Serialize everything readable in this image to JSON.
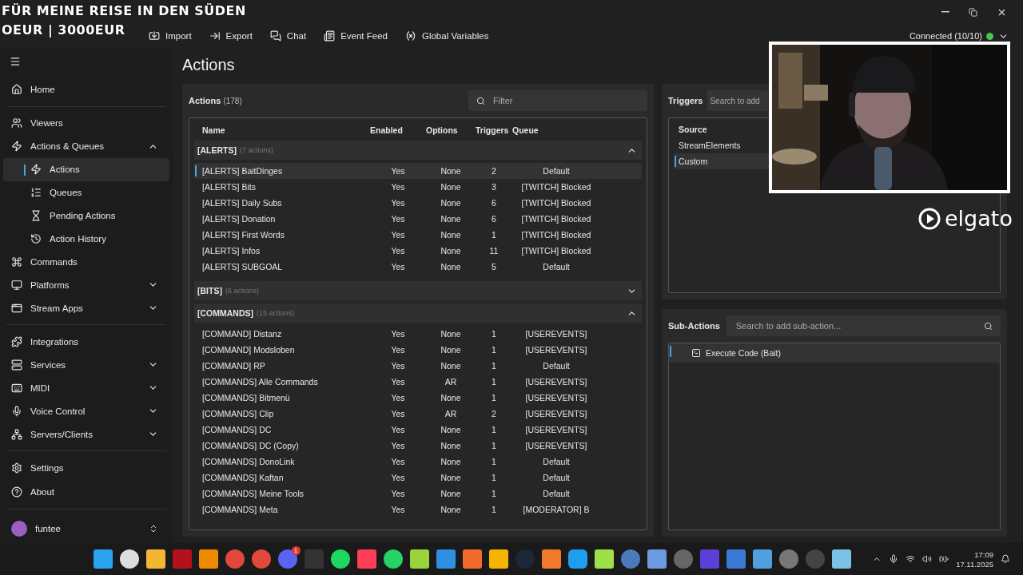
{
  "overlay_banner": [
    "FÜR MEINE REISE IN DEN SÜDEN",
    "OEUR | 3000EUR"
  ],
  "toolbar": [
    {
      "kind": "import",
      "label": "Import"
    },
    {
      "kind": "export",
      "label": "Export"
    },
    {
      "kind": "chat",
      "label": "Chat"
    },
    {
      "kind": "feed",
      "label": "Event Feed"
    },
    {
      "kind": "variables",
      "label": "Global Variables"
    }
  ],
  "connection": {
    "label": "Connected (10/10)",
    "color": "#4cc24a"
  },
  "sidebar": {
    "items": [
      {
        "label": "Home"
      },
      {
        "label": "Viewers"
      },
      {
        "label": "Actions & Queues",
        "expanded": true,
        "children": [
          {
            "label": "Actions",
            "selected": true
          },
          {
            "label": "Queues",
            "selected": false
          },
          {
            "label": "Pending Actions",
            "selected": false
          },
          {
            "label": "Action History",
            "selected": false
          }
        ]
      },
      {
        "label": "Commands"
      },
      {
        "label": "Platforms",
        "expanded": false
      },
      {
        "label": "Stream Apps",
        "expanded": false
      },
      {
        "label": "Integrations"
      },
      {
        "label": "Services",
        "expanded": false
      },
      {
        "label": "MIDI",
        "expanded": false
      },
      {
        "label": "Voice Control",
        "expanded": false
      },
      {
        "label": "Servers/Clients",
        "expanded": false
      }
    ],
    "footer": [
      {
        "label": "Settings"
      },
      {
        "label": "About"
      }
    ],
    "user": "funtee"
  },
  "page_title": "Actions",
  "actions": {
    "title": "Actions",
    "count": "(178)",
    "filter_placeholder": "Filter",
    "columns": [
      "Name",
      "Enabled",
      "Options",
      "Triggers",
      "Queue"
    ],
    "groups": [
      {
        "name": "[ALERTS]",
        "count": "(7 actions)",
        "expanded": true,
        "rows": [
          {
            "name": "[ALERTS] BaitDinges",
            "enabled": "Yes",
            "options": "None",
            "triggers": "2",
            "queue": "Default",
            "selected": true
          },
          {
            "name": "[ALERTS] Bits",
            "enabled": "Yes",
            "options": "None",
            "triggers": "3",
            "queue": "[TWITCH] Blocked",
            "selected": false
          },
          {
            "name": "[ALERTS] Daily Subs",
            "enabled": "Yes",
            "options": "None",
            "triggers": "6",
            "queue": "[TWITCH] Blocked",
            "selected": false
          },
          {
            "name": "[ALERTS] Donation",
            "enabled": "Yes",
            "options": "None",
            "triggers": "6",
            "queue": "[TWITCH] Blocked",
            "selected": false
          },
          {
            "name": "[ALERTS] First Words",
            "enabled": "Yes",
            "options": "None",
            "triggers": "1",
            "queue": "[TWITCH] Blocked",
            "selected": false
          },
          {
            "name": "[ALERTS] Infos",
            "enabled": "Yes",
            "options": "None",
            "triggers": "11",
            "queue": "[TWITCH] Blocked",
            "selected": false
          },
          {
            "name": "[ALERTS] SUBGOAL",
            "enabled": "Yes",
            "options": "None",
            "triggers": "5",
            "queue": "Default",
            "selected": false
          }
        ]
      },
      {
        "name": "[BITS]",
        "count": "(6 actions)",
        "expanded": false
      },
      {
        "name": "[COMMANDS]",
        "count": "(15 actions)",
        "expanded": true,
        "rows": [
          {
            "name": "[COMMAND] Distanz",
            "enabled": "Yes",
            "options": "None",
            "triggers": "1",
            "queue": "[USEREVENTS]",
            "selected": false
          },
          {
            "name": "[COMMAND] Modsloben",
            "enabled": "Yes",
            "options": "None",
            "triggers": "1",
            "queue": "[USEREVENTS]",
            "selected": false
          },
          {
            "name": "[COMMAND] RP",
            "enabled": "Yes",
            "options": "None",
            "triggers": "1",
            "queue": "Default",
            "selected": false
          },
          {
            "name": "[COMMANDS] Alle Commands",
            "enabled": "Yes",
            "options": "AR",
            "triggers": "1",
            "queue": "[USEREVENTS]",
            "selected": false
          },
          {
            "name": "[COMMANDS] Bitmenü",
            "enabled": "Yes",
            "options": "None",
            "triggers": "1",
            "queue": "[USEREVENTS]",
            "selected": false
          },
          {
            "name": "[COMMANDS] Clip",
            "enabled": "Yes",
            "options": "AR",
            "triggers": "2",
            "queue": "[USEREVENTS]",
            "selected": false
          },
          {
            "name": "[COMMANDS] DC",
            "enabled": "Yes",
            "options": "None",
            "triggers": "1",
            "queue": "[USEREVENTS]",
            "selected": false
          },
          {
            "name": "[COMMANDS] DC (Copy)",
            "enabled": "Yes",
            "options": "None",
            "triggers": "1",
            "queue": "[USEREVENTS]",
            "selected": false
          },
          {
            "name": "[COMMANDS] DonoLink",
            "enabled": "Yes",
            "options": "None",
            "triggers": "1",
            "queue": "Default",
            "selected": false
          },
          {
            "name": "[COMMANDS] Kaftan",
            "enabled": "Yes",
            "options": "None",
            "triggers": "1",
            "queue": "Default",
            "selected": false
          },
          {
            "name": "[COMMANDS] Meine Tools",
            "enabled": "Yes",
            "options": "None",
            "triggers": "1",
            "queue": "Default",
            "selected": false
          },
          {
            "name": "[COMMANDS] Meta",
            "enabled": "Yes",
            "options": "None",
            "triggers": "1",
            "queue": "[MODERATOR] B",
            "selected": false
          }
        ]
      }
    ]
  },
  "triggers": {
    "title": "Triggers",
    "search_placeholder": "Search to add",
    "columns": [
      "Source"
    ],
    "rows": [
      {
        "source": "StreamElements",
        "selected": false
      },
      {
        "source": "Custom",
        "selected": true
      }
    ]
  },
  "sub_actions": {
    "title": "Sub-Actions",
    "search_placeholder": "Search to add sub-action...",
    "rows": [
      {
        "label": "Execute Code (Bait)",
        "selected": true
      }
    ]
  },
  "webcam": {
    "kind": "picture",
    "logo": "elgato"
  },
  "taskbar": {
    "discord_badge": "1",
    "time": "17:09",
    "date": "17.11.2025"
  }
}
